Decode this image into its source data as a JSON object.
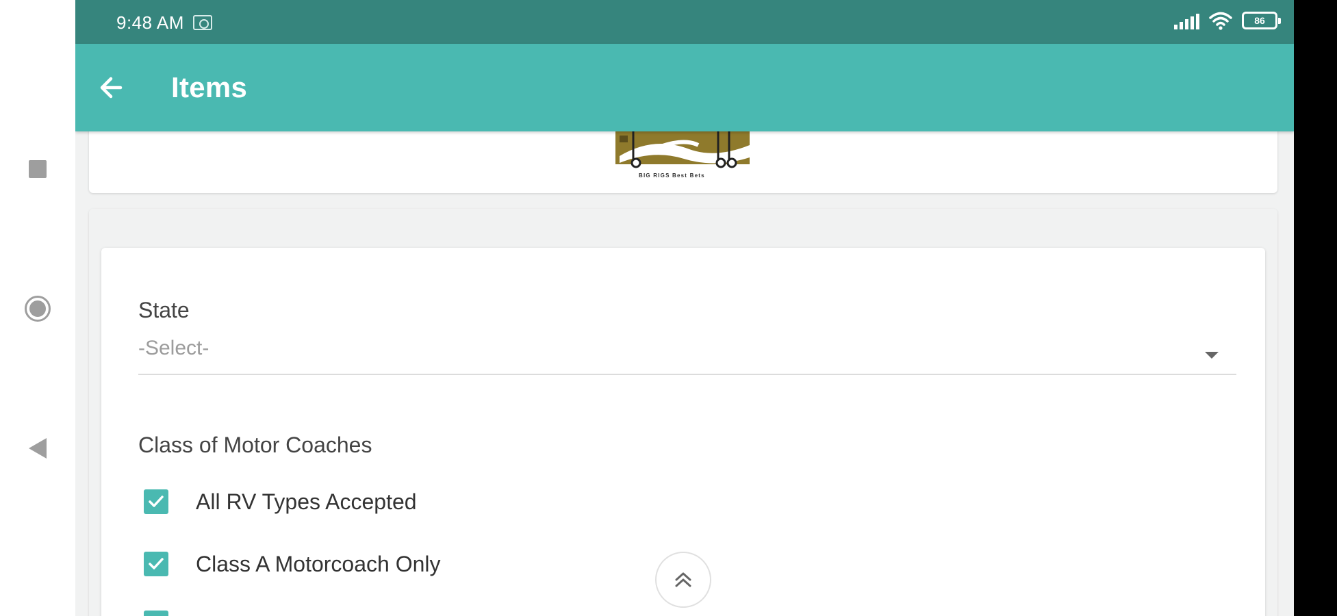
{
  "status_bar": {
    "time": "9:48 AM",
    "battery": "86"
  },
  "app_bar": {
    "title": "Items"
  },
  "form": {
    "state": {
      "label": "State",
      "selected_value": "-Select-"
    },
    "class_of_motor_coaches": {
      "label": "Class of Motor Coaches",
      "options": [
        {
          "label": "All RV Types Accepted",
          "checked": true
        },
        {
          "label": "Class A Motorcoach Only",
          "checked": true
        }
      ]
    }
  },
  "logo": {
    "caption": "BIG RIGS Best Bets"
  },
  "icons": {
    "nav": [
      "recents-square-icon",
      "home-circle-icon",
      "back-triangle-icon"
    ],
    "app_bar": "arrow-left-icon",
    "scroll": "double-chevron-up-icon"
  },
  "colors": {
    "status_bar": "#36857d",
    "app_bar": "#4ab9b1",
    "checkbox": "#4ab9b1",
    "logo_gold": "#8f7a2c"
  }
}
